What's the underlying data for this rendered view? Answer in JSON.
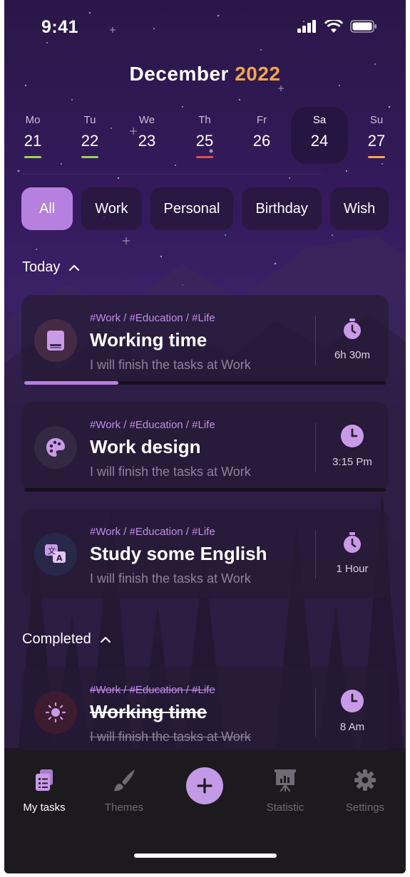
{
  "status": {
    "time": "9:41"
  },
  "header": {
    "month": "December",
    "year": "2022"
  },
  "days": [
    {
      "name": "Mo",
      "num": "21",
      "bar": "#9bd45a",
      "selected": false
    },
    {
      "name": "Tu",
      "num": "22",
      "bar": "#9bd45a",
      "selected": false
    },
    {
      "name": "We",
      "num": "23",
      "bar": "",
      "selected": false
    },
    {
      "name": "Th",
      "num": "25",
      "bar": "#e25050",
      "selected": false
    },
    {
      "name": "Fr",
      "num": "26",
      "bar": "",
      "selected": false
    },
    {
      "name": "Sa",
      "num": "24",
      "bar": "",
      "selected": true
    },
    {
      "name": "Su",
      "num": "27",
      "bar": "#f1a64b",
      "selected": false
    }
  ],
  "filters": [
    "All",
    "Work",
    "Personal",
    "Birthday",
    "Wish"
  ],
  "sections": {
    "today": "Today",
    "completed": "Completed"
  },
  "tasks": [
    {
      "tags": "#Work / #Education / #Life",
      "title": "Working time",
      "subtitle": "I will finish the tasks at Work",
      "time": "6h 30m",
      "icon": "book-icon",
      "right_icon": "stopwatch-icon",
      "progress": 0.26
    },
    {
      "tags": "#Work / #Education / #Life",
      "title": "Work design",
      "subtitle": "I will finish the tasks at Work",
      "time": "3:15 Pm",
      "icon": "palette-icon",
      "right_icon": "clock-icon",
      "progress": 0
    },
    {
      "tags": "#Work / #Education / #Life",
      "title": "Study some English",
      "subtitle": "I will finish the tasks at Work",
      "time": "1  Hour",
      "icon": "translate-icon",
      "right_icon": "stopwatch-icon"
    }
  ],
  "completed": [
    {
      "tags": "#Work / #Education / #Life",
      "title": "Working time",
      "subtitle": "I will finish the tasks at Work",
      "time": "8 Am",
      "icon": "sun-icon",
      "right_icon": "clock-icon"
    }
  ],
  "nav": {
    "my_tasks": "My tasks",
    "themes": "Themes",
    "statistic": "Statistic",
    "settings": "Settings"
  },
  "colors": {
    "accent": "#b580e0",
    "year": "#f1a64b"
  }
}
